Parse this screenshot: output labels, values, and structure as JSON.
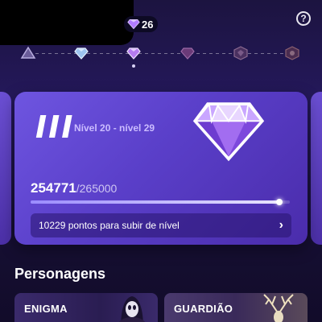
{
  "header": {
    "gem_count": "26",
    "help_label": "?"
  },
  "tier_track": {
    "steps": [
      "bronze-tier-icon",
      "silver-tier-icon",
      "amethyst-tier-icon",
      "ruby-tier-icon",
      "emblem-tier-icon",
      "crown-tier-icon"
    ],
    "current_step": "amethyst-tier-icon"
  },
  "level_card": {
    "tier_numeral": "III",
    "level_range": "Nível 20 - nível 29",
    "points_current": "254771",
    "points_total": "/265000",
    "progress_fraction": 0.961,
    "next_level_text": "10229 pontos para subir de nível",
    "chevron": "›"
  },
  "characters": {
    "section_title": "Personagens",
    "items": [
      {
        "name": "ENIGMA"
      },
      {
        "name": "GUARDIÃO"
      }
    ]
  },
  "colors": {
    "gem_top": "#c9a6ff",
    "gem_mid": "#a26df0",
    "gem_dark": "#6e3cd0",
    "accent": "#7c5cf0"
  }
}
